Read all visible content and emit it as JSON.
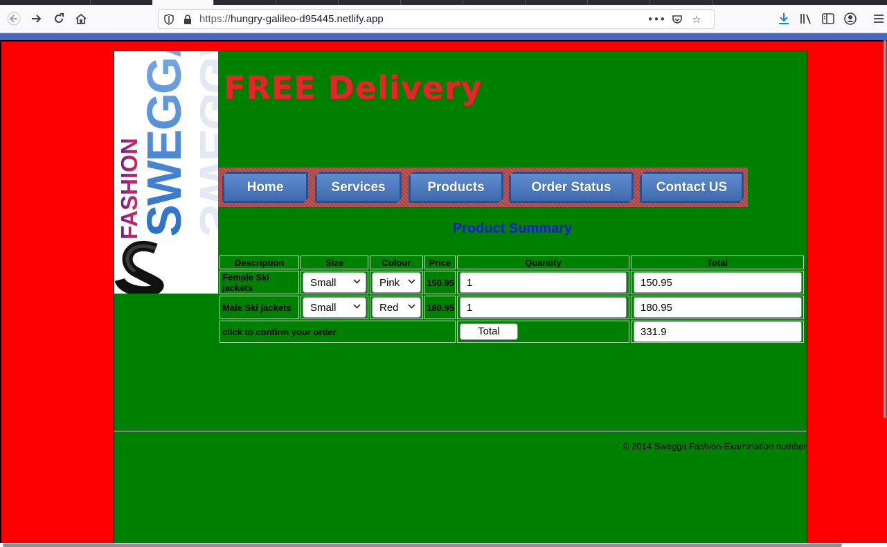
{
  "browser": {
    "url_scheme": "https://",
    "url_host": "hungry-galileo-d95445.netlify.app",
    "icons": {
      "back": "back-arrow-icon",
      "forward": "forward-arrow-icon",
      "reload": "reload-icon",
      "home": "home-icon",
      "more": "more-dots-icon",
      "pocket": "pocket-icon",
      "bookmark": "star-icon",
      "download": "download-icon",
      "library": "library-icon",
      "sidebar": "sidebar-icon",
      "account": "account-icon",
      "menu": "hamburger-icon"
    },
    "accent_color": "#4966b8"
  },
  "site": {
    "colors": {
      "page_bg": "#ff0000",
      "container_bg": "#008000",
      "banner_text": "#e0282a",
      "nav_button": "#4a78c0",
      "title": "#1a1adb"
    },
    "banner": "FREE Delivery",
    "logo": {
      "word_small": "FASHION",
      "word_large": "SWEGGA"
    },
    "nav": [
      "Home",
      "Services",
      "Products",
      "Order Status",
      "Contact US"
    ],
    "title": "Product Summary",
    "table": {
      "headers": {
        "description": "Description",
        "size": "Size",
        "colour": "Colour",
        "price": "Price",
        "quantity": "Quantity",
        "total": "Total"
      },
      "rows": [
        {
          "description": "Female Ski jackets",
          "size": "Small",
          "colour": "Pink",
          "price": "150.95",
          "quantity": "1",
          "total": "150.95"
        },
        {
          "description": "Male Ski jackets",
          "size": "Small",
          "colour": "Red",
          "price": "180.95",
          "quantity": "1",
          "total": "180.95"
        }
      ],
      "confirm_text": "click to confirm your order",
      "total_button": "Total",
      "grand_total": "331.9"
    },
    "footer": "© 2014 Swegga Fashion-Examination number"
  }
}
